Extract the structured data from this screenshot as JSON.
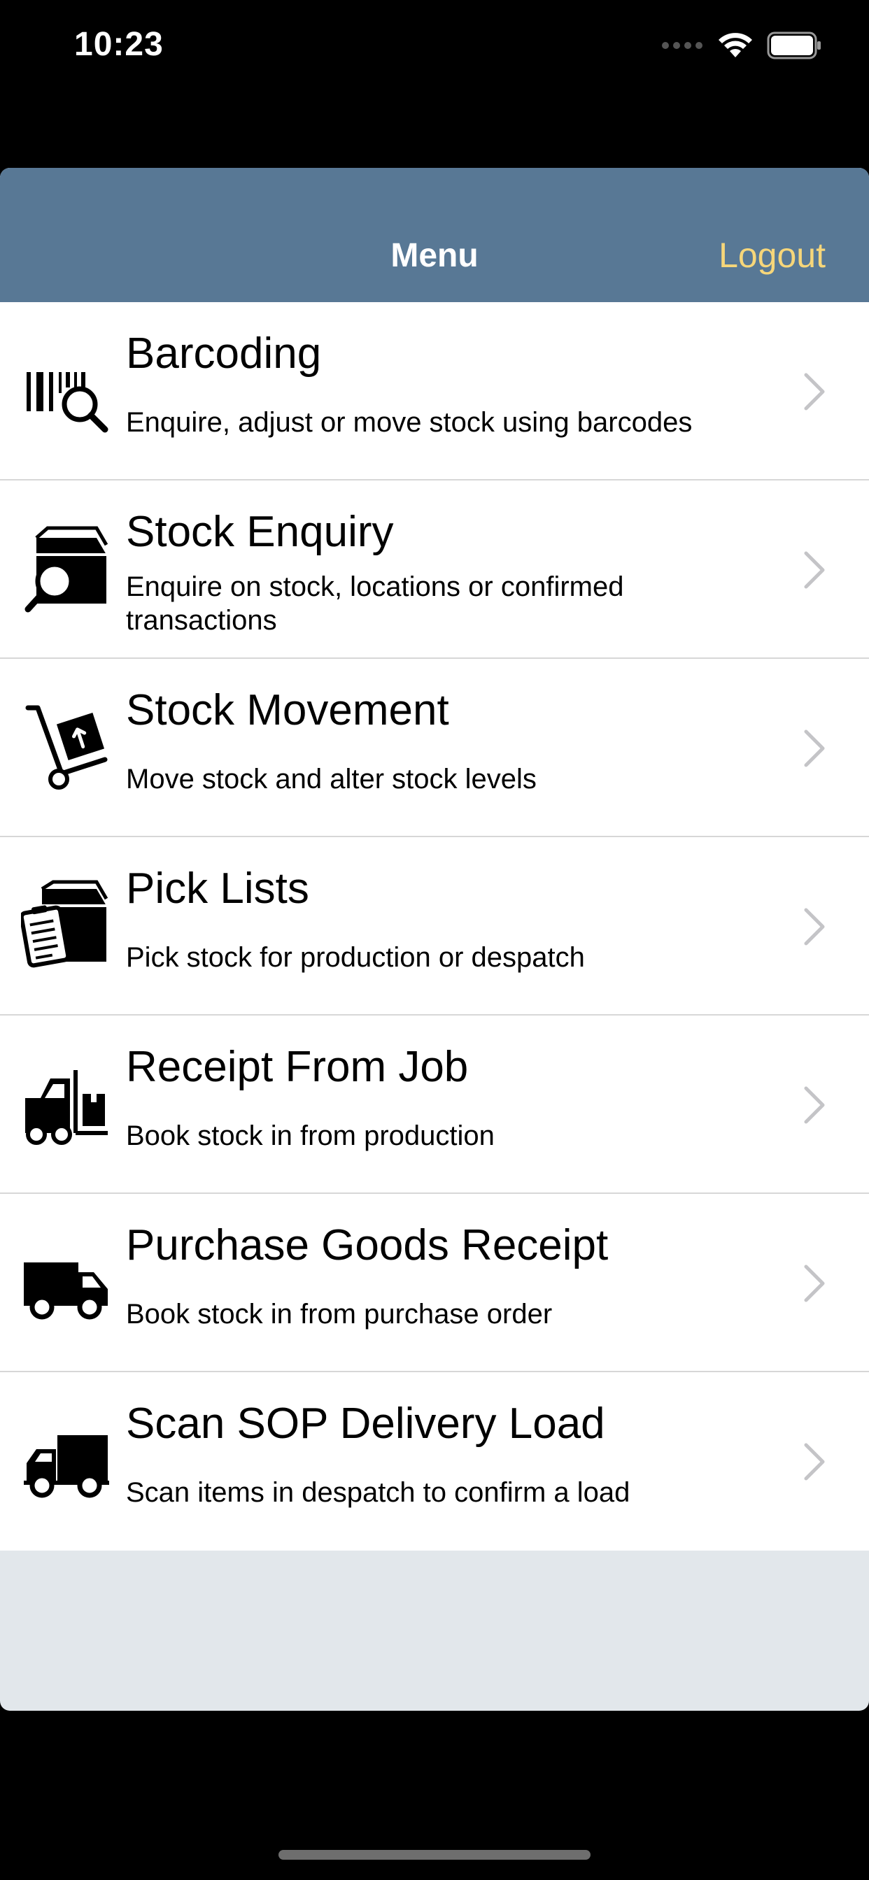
{
  "status_bar": {
    "time": "10:23"
  },
  "nav": {
    "title": "Menu",
    "logout_label": "Logout"
  },
  "colors": {
    "nav_background": "#587895",
    "logout_text": "#f6d67a",
    "sheet_background": "#e2e7eb"
  },
  "menu": {
    "items": [
      {
        "title": "Barcoding",
        "subtitle": "Enquire, adjust or move stock using barcodes",
        "icon": "barcode-search-icon"
      },
      {
        "title": "Stock Enquiry",
        "subtitle": "Enquire on stock, locations or confirmed transactions",
        "icon": "box-search-icon"
      },
      {
        "title": "Stock Movement",
        "subtitle": "Move stock and alter stock levels",
        "icon": "hand-truck-icon"
      },
      {
        "title": "Pick Lists",
        "subtitle": "Pick stock for production or despatch",
        "icon": "box-clipboard-icon"
      },
      {
        "title": "Receipt From Job",
        "subtitle": "Book stock in from production",
        "icon": "forklift-icon"
      },
      {
        "title": "Purchase Goods Receipt",
        "subtitle": "Book stock in from purchase order",
        "icon": "delivery-van-icon"
      },
      {
        "title": "Scan SOP Delivery Load",
        "subtitle": "Scan items in despatch to confirm a load",
        "icon": "delivery-truck-icon"
      }
    ]
  }
}
